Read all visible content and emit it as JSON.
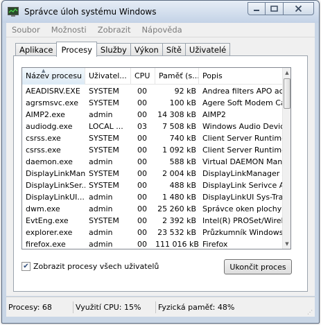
{
  "window": {
    "title": "Správce úloh systému Windows"
  },
  "menu": [
    "Soubor",
    "Možnosti",
    "Zobrazit",
    "Nápověda"
  ],
  "tabs": [
    {
      "label": "Aplikace",
      "active": false
    },
    {
      "label": "Procesy",
      "active": true
    },
    {
      "label": "Služby",
      "active": false
    },
    {
      "label": "Výkon",
      "active": false
    },
    {
      "label": "Sítě",
      "active": false
    },
    {
      "label": "Uživatelé",
      "active": false
    }
  ],
  "columns": [
    "Název procesu",
    "Uživatel...",
    "CPU",
    "Paměť (s...",
    "Popis"
  ],
  "rows": [
    [
      "AEADISRV.EXE",
      "SYSTEM",
      "00",
      "92 kB",
      "Andrea filters APO acc"
    ],
    [
      "agrsmsvc.exe",
      "SYSTEM",
      "00",
      "100 kB",
      "Agere Soft Modem Cal"
    ],
    [
      "AIMP2.exe",
      "admin",
      "00",
      "14 308 kB",
      "AIMP2"
    ],
    [
      "audiodg.exe",
      "LOCAL ...",
      "03",
      "7 508 kB",
      "Windows Audio Device"
    ],
    [
      "csrss.exe",
      "SYSTEM",
      "00",
      "740 kB",
      "Client Server Runtime"
    ],
    [
      "csrss.exe",
      "SYSTEM",
      "00",
      "1 092 kB",
      "Client Server Runtime"
    ],
    [
      "daemon.exe",
      "admin",
      "00",
      "588 kB",
      "Virtual DAEMON Mana"
    ],
    [
      "DisplayLinkMan...",
      "SYSTEM",
      "00",
      "2 004 kB",
      "DisplayLinkManager Ap"
    ],
    [
      "DisplayLinkSer...",
      "SYSTEM",
      "00",
      "488 kB",
      "DisplayLink Serivce App"
    ],
    [
      "DisplayLinkUI....",
      "admin",
      "00",
      "1 480 kB",
      "DisplayLinkUI Sys-Tray"
    ],
    [
      "dwm.exe",
      "admin",
      "00",
      "25 260 kB",
      "Správce oken plochy"
    ],
    [
      "EvtEng.exe",
      "SYSTEM",
      "00",
      "2 392 kB",
      "Intel(R) PROSet/Wirele"
    ],
    [
      "explorer.exe",
      "admin",
      "00",
      "23 532 kB",
      "Průzkumník Windows"
    ],
    [
      "firefox.exe",
      "admin",
      "00",
      "111 016 kB",
      "Firefox"
    ]
  ],
  "show_all_label": "Zobrazit procesy všech uživatelů",
  "show_all_checked": true,
  "end_process_label": "Ukončit proces",
  "status": {
    "processes": "Procesy: 68",
    "cpu": "Využití CPU: 15%",
    "memory": "Fyzická paměť: 48%"
  }
}
